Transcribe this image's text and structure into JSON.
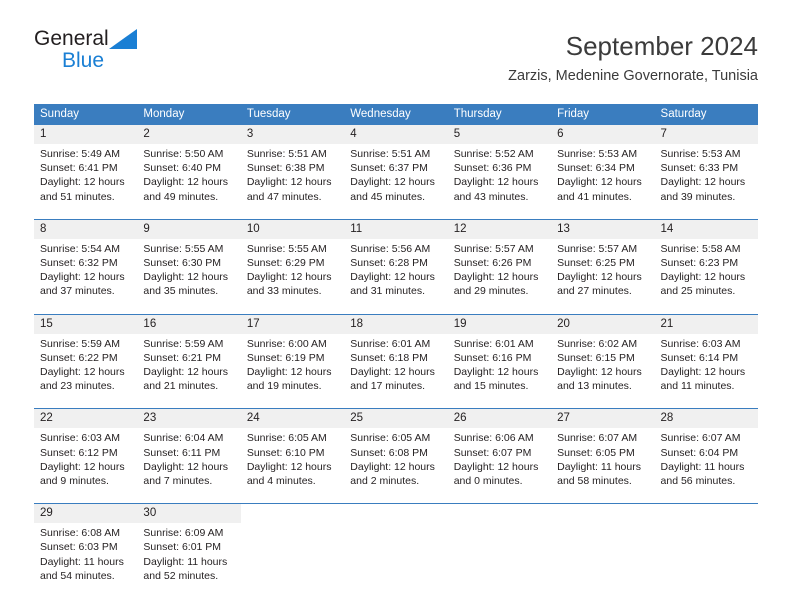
{
  "brand": {
    "name_part1": "General",
    "name_part2": "Blue",
    "triangle_color": "#1a7fd4"
  },
  "header": {
    "title": "September 2024",
    "location": "Zarzis, Medenine Governorate, Tunisia"
  },
  "theme": {
    "header_bar_color": "#3a7dbf",
    "day_number_band_color": "#f0f0f0",
    "text_color": "#231f20"
  },
  "calendar": {
    "weekday_headers": [
      "Sunday",
      "Monday",
      "Tuesday",
      "Wednesday",
      "Thursday",
      "Friday",
      "Saturday"
    ],
    "weeks": [
      [
        {
          "day": "1",
          "lines": [
            "Sunrise: 5:49 AM",
            "Sunset: 6:41 PM",
            "Daylight: 12 hours",
            "and 51 minutes."
          ]
        },
        {
          "day": "2",
          "lines": [
            "Sunrise: 5:50 AM",
            "Sunset: 6:40 PM",
            "Daylight: 12 hours",
            "and 49 minutes."
          ]
        },
        {
          "day": "3",
          "lines": [
            "Sunrise: 5:51 AM",
            "Sunset: 6:38 PM",
            "Daylight: 12 hours",
            "and 47 minutes."
          ]
        },
        {
          "day": "4",
          "lines": [
            "Sunrise: 5:51 AM",
            "Sunset: 6:37 PM",
            "Daylight: 12 hours",
            "and 45 minutes."
          ]
        },
        {
          "day": "5",
          "lines": [
            "Sunrise: 5:52 AM",
            "Sunset: 6:36 PM",
            "Daylight: 12 hours",
            "and 43 minutes."
          ]
        },
        {
          "day": "6",
          "lines": [
            "Sunrise: 5:53 AM",
            "Sunset: 6:34 PM",
            "Daylight: 12 hours",
            "and 41 minutes."
          ]
        },
        {
          "day": "7",
          "lines": [
            "Sunrise: 5:53 AM",
            "Sunset: 6:33 PM",
            "Daylight: 12 hours",
            "and 39 minutes."
          ]
        }
      ],
      [
        {
          "day": "8",
          "lines": [
            "Sunrise: 5:54 AM",
            "Sunset: 6:32 PM",
            "Daylight: 12 hours",
            "and 37 minutes."
          ]
        },
        {
          "day": "9",
          "lines": [
            "Sunrise: 5:55 AM",
            "Sunset: 6:30 PM",
            "Daylight: 12 hours",
            "and 35 minutes."
          ]
        },
        {
          "day": "10",
          "lines": [
            "Sunrise: 5:55 AM",
            "Sunset: 6:29 PM",
            "Daylight: 12 hours",
            "and 33 minutes."
          ]
        },
        {
          "day": "11",
          "lines": [
            "Sunrise: 5:56 AM",
            "Sunset: 6:28 PM",
            "Daylight: 12 hours",
            "and 31 minutes."
          ]
        },
        {
          "day": "12",
          "lines": [
            "Sunrise: 5:57 AM",
            "Sunset: 6:26 PM",
            "Daylight: 12 hours",
            "and 29 minutes."
          ]
        },
        {
          "day": "13",
          "lines": [
            "Sunrise: 5:57 AM",
            "Sunset: 6:25 PM",
            "Daylight: 12 hours",
            "and 27 minutes."
          ]
        },
        {
          "day": "14",
          "lines": [
            "Sunrise: 5:58 AM",
            "Sunset: 6:23 PM",
            "Daylight: 12 hours",
            "and 25 minutes."
          ]
        }
      ],
      [
        {
          "day": "15",
          "lines": [
            "Sunrise: 5:59 AM",
            "Sunset: 6:22 PM",
            "Daylight: 12 hours",
            "and 23 minutes."
          ]
        },
        {
          "day": "16",
          "lines": [
            "Sunrise: 5:59 AM",
            "Sunset: 6:21 PM",
            "Daylight: 12 hours",
            "and 21 minutes."
          ]
        },
        {
          "day": "17",
          "lines": [
            "Sunrise: 6:00 AM",
            "Sunset: 6:19 PM",
            "Daylight: 12 hours",
            "and 19 minutes."
          ]
        },
        {
          "day": "18",
          "lines": [
            "Sunrise: 6:01 AM",
            "Sunset: 6:18 PM",
            "Daylight: 12 hours",
            "and 17 minutes."
          ]
        },
        {
          "day": "19",
          "lines": [
            "Sunrise: 6:01 AM",
            "Sunset: 6:16 PM",
            "Daylight: 12 hours",
            "and 15 minutes."
          ]
        },
        {
          "day": "20",
          "lines": [
            "Sunrise: 6:02 AM",
            "Sunset: 6:15 PM",
            "Daylight: 12 hours",
            "and 13 minutes."
          ]
        },
        {
          "day": "21",
          "lines": [
            "Sunrise: 6:03 AM",
            "Sunset: 6:14 PM",
            "Daylight: 12 hours",
            "and 11 minutes."
          ]
        }
      ],
      [
        {
          "day": "22",
          "lines": [
            "Sunrise: 6:03 AM",
            "Sunset: 6:12 PM",
            "Daylight: 12 hours",
            "and 9 minutes."
          ]
        },
        {
          "day": "23",
          "lines": [
            "Sunrise: 6:04 AM",
            "Sunset: 6:11 PM",
            "Daylight: 12 hours",
            "and 7 minutes."
          ]
        },
        {
          "day": "24",
          "lines": [
            "Sunrise: 6:05 AM",
            "Sunset: 6:10 PM",
            "Daylight: 12 hours",
            "and 4 minutes."
          ]
        },
        {
          "day": "25",
          "lines": [
            "Sunrise: 6:05 AM",
            "Sunset: 6:08 PM",
            "Daylight: 12 hours",
            "and 2 minutes."
          ]
        },
        {
          "day": "26",
          "lines": [
            "Sunrise: 6:06 AM",
            "Sunset: 6:07 PM",
            "Daylight: 12 hours",
            "and 0 minutes."
          ]
        },
        {
          "day": "27",
          "lines": [
            "Sunrise: 6:07 AM",
            "Sunset: 6:05 PM",
            "Daylight: 11 hours",
            "and 58 minutes."
          ]
        },
        {
          "day": "28",
          "lines": [
            "Sunrise: 6:07 AM",
            "Sunset: 6:04 PM",
            "Daylight: 11 hours",
            "and 56 minutes."
          ]
        }
      ],
      [
        {
          "day": "29",
          "lines": [
            "Sunrise: 6:08 AM",
            "Sunset: 6:03 PM",
            "Daylight: 11 hours",
            "and 54 minutes."
          ]
        },
        {
          "day": "30",
          "lines": [
            "Sunrise: 6:09 AM",
            "Sunset: 6:01 PM",
            "Daylight: 11 hours",
            "and 52 minutes."
          ]
        },
        {
          "day": "",
          "lines": []
        },
        {
          "day": "",
          "lines": []
        },
        {
          "day": "",
          "lines": []
        },
        {
          "day": "",
          "lines": []
        },
        {
          "day": "",
          "lines": []
        }
      ]
    ]
  }
}
